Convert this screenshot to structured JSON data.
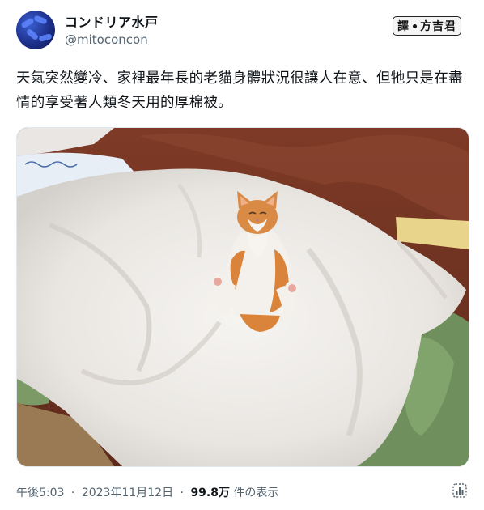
{
  "author": {
    "display_name": "コンドリア水戸",
    "handle": "@mitoconcon"
  },
  "translation_badge": {
    "label_left": "譯",
    "label_right": "方吉君"
  },
  "tweet": {
    "text": "天氣突然變冷、家裡最年長的老貓身體狀況很讓人在意、但牠只是在盡情的享受著人類冬天用的厚棉被。"
  },
  "meta": {
    "time": "午後5:03",
    "separator": "·",
    "date": "2023年11月12日",
    "views_count": "99.8万",
    "views_label": "件の表示"
  },
  "colors": {
    "text": "#0f1419",
    "secondary": "#536471"
  },
  "icons": {
    "views": "bar-chart-icon"
  }
}
